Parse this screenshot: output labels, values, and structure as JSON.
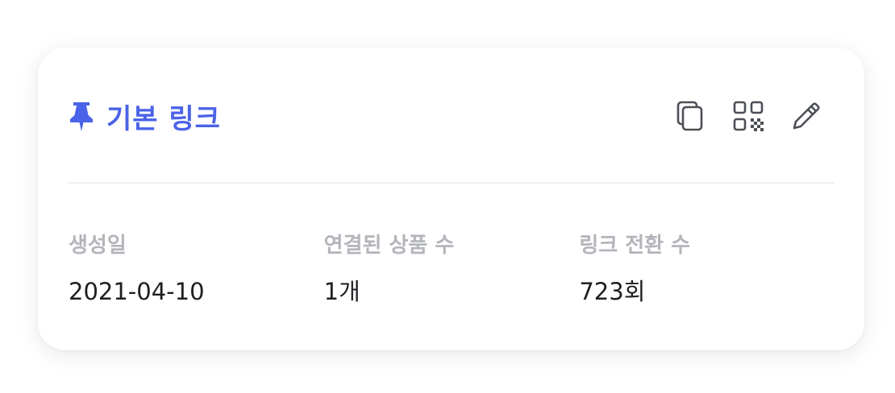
{
  "card": {
    "title": "기본 링크",
    "accent_color": "#4a63e8",
    "icons": {
      "pin": "pushpin-icon",
      "copy": "copy-icon",
      "qr": "qr-code-icon",
      "edit": "pencil-icon"
    }
  },
  "stats": [
    {
      "label": "생성일",
      "value": "2021-04-10"
    },
    {
      "label": "연결된 상품 수",
      "value": "1개"
    },
    {
      "label": "링크 전환 수",
      "value": "723회"
    }
  ]
}
